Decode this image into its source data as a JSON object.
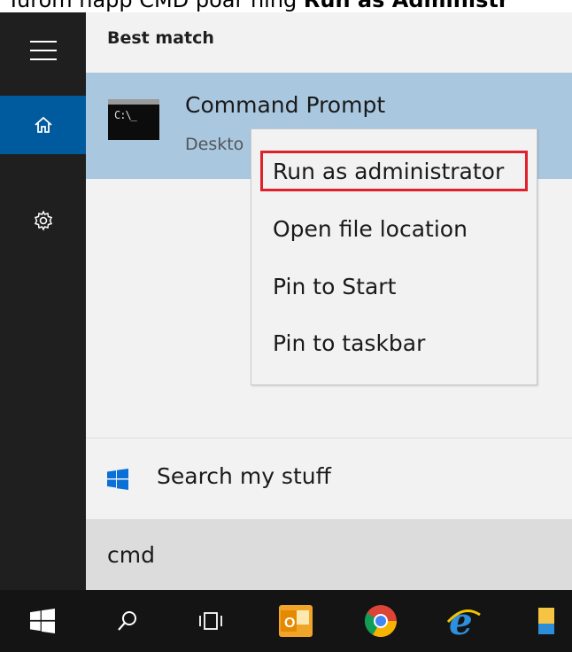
{
  "caption": {
    "text_start": "Turom nápp CMD poar ning ",
    "text_bold": "Run as Administr"
  },
  "rail": {
    "items": [
      "menu",
      "home",
      "settings"
    ]
  },
  "panel": {
    "best_match": "Best match",
    "result": {
      "title": "Command Prompt",
      "subtitle": "Deskto",
      "icon_text": "C:\\_"
    },
    "search_stuff": "Search my stuff",
    "query": "cmd"
  },
  "context_menu": {
    "items": [
      "Run as administrator",
      "Open file location",
      "Pin to Start",
      "Pin to taskbar"
    ]
  },
  "taskbar": {
    "items": [
      "start",
      "search",
      "task-view",
      "outlook",
      "chrome",
      "internet-explorer",
      "file-explorer"
    ]
  },
  "colors": {
    "rail_bg": "#1f1f1f",
    "rail_active": "#005a9e",
    "panel_bg": "#f2f2f2",
    "selected_result": "#a9c8e0",
    "highlight_border": "#e0202a",
    "taskbar_bg": "#141414"
  }
}
